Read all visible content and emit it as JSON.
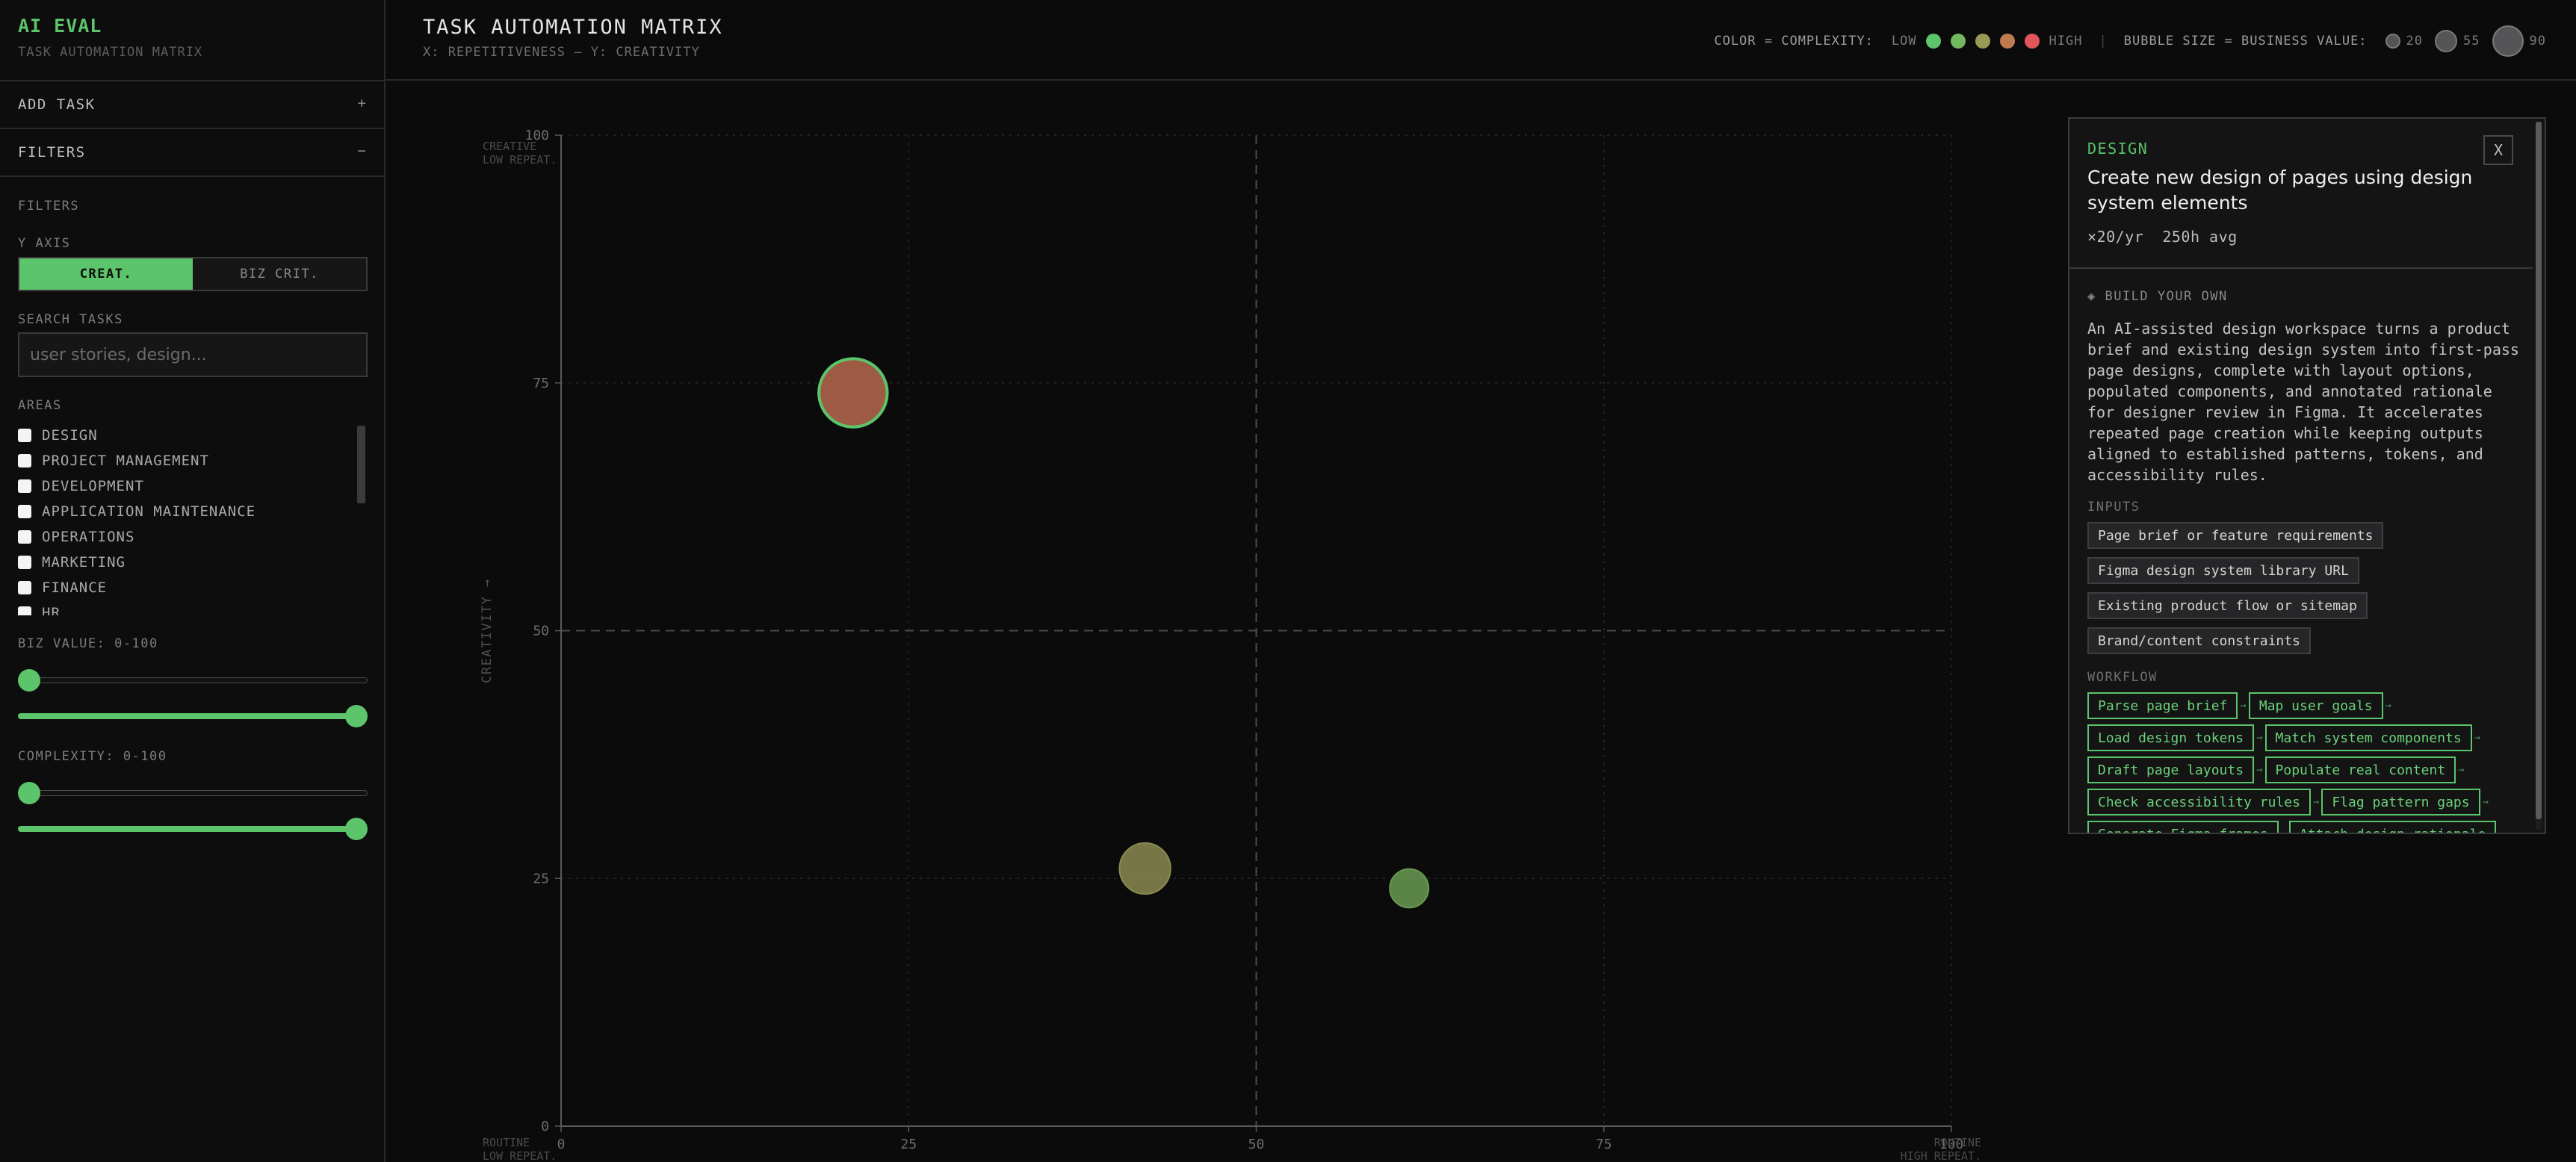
{
  "app": {
    "brand": "AI EVAL",
    "brand_sub": "TASK AUTOMATION MATRIX"
  },
  "sidebar": {
    "add_task": {
      "label": "ADD TASK",
      "icon": "+"
    },
    "filters": {
      "label": "FILTERS",
      "icon": "−"
    },
    "filters_heading": "FILTERS",
    "y_axis": {
      "label": "Y AXIS",
      "options": [
        "CREAT.",
        "BIZ CRIT."
      ],
      "selected": "CREAT."
    },
    "search": {
      "label": "SEARCH TASKS",
      "placeholder": "user stories, design...",
      "value": ""
    },
    "areas": {
      "label": "AREAS",
      "items": [
        "DESIGN",
        "PROJECT MANAGEMENT",
        "DEVELOPMENT",
        "APPLICATION MAINTENANCE",
        "OPERATIONS",
        "MARKETING",
        "FINANCE",
        "HR"
      ],
      "checked": [
        false,
        false,
        false,
        false,
        false,
        false,
        false,
        false
      ]
    },
    "biz_value": {
      "label": "BIZ VALUE: 0-100",
      "min": 0,
      "max": 100
    },
    "complexity": {
      "label": "COMPLEXITY: 0-100",
      "min": 0,
      "max": 100
    }
  },
  "header": {
    "title": "TASK AUTOMATION MATRIX",
    "subtitle": "X: REPETITIVENESS — Y: CREATIVITY",
    "legend": {
      "color_label": "COLOR = COMPLEXITY:",
      "low": "LOW",
      "high": "HIGH",
      "separator": "|",
      "complexity_colors": [
        "#5cc46a",
        "#71b85e",
        "#9a9a56",
        "#c07a50",
        "#e0565a"
      ],
      "size_label": "BUBBLE SIZE = BUSINESS VALUE:",
      "sizes": [
        "20",
        "55",
        "90"
      ]
    }
  },
  "chart_data": {
    "type": "scatter",
    "xlabel": "",
    "ylabel": "CREATIVITY →",
    "xlim": [
      0,
      100
    ],
    "ylim": [
      0,
      100
    ],
    "xticks": [
      "0",
      "25",
      "50",
      "75",
      "100"
    ],
    "yticks": [
      "0",
      "25",
      "50",
      "75",
      "100"
    ],
    "grid": true,
    "quadrant_labels": {
      "top_left": [
        "CREATIVE",
        "LOW REPEAT."
      ],
      "bottom_left": [
        "ROUTINE",
        "LOW REPEAT."
      ],
      "bottom_right": [
        "ROUTINE",
        "HIGH REPEAT."
      ]
    },
    "points": [
      {
        "x": 21,
        "y": 74,
        "size": 90,
        "color": "#b86a4e",
        "selected": true
      },
      {
        "x": 42,
        "y": 26,
        "size": 55,
        "color": "#8a8a52"
      },
      {
        "x": 61,
        "y": 24,
        "size": 30,
        "color": "#6a9a52"
      }
    ]
  },
  "panel": {
    "category": "DESIGN",
    "close": "X",
    "title": "Create new design of pages using design system elements",
    "meta": "×20/yr  250h avg",
    "build_label": "◈ BUILD YOUR OWN",
    "description": "An AI-assisted design workspace turns a product brief and existing design system into first-pass page designs, complete with layout options, populated components, and annotated rationale for designer review in Figma. It accelerates repeated page creation while keeping outputs aligned to established patterns, tokens, and accessibility rules.",
    "inputs_label": "INPUTS",
    "inputs": [
      "Page brief or feature requirements",
      "Figma design system library URL",
      "Existing product flow or sitemap",
      "Brand/content constraints"
    ],
    "workflow_label": "WORKFLOW",
    "workflow": [
      [
        "Parse page brief",
        "Map user goals"
      ],
      [
        "Load design tokens",
        "Match system components"
      ],
      [
        "Draft page layouts",
        "Populate real content"
      ],
      [
        "Check accessibility rules",
        "Flag pattern gaps"
      ],
      [
        "Generate Figma frames",
        "Attach design rationale"
      ]
    ]
  }
}
